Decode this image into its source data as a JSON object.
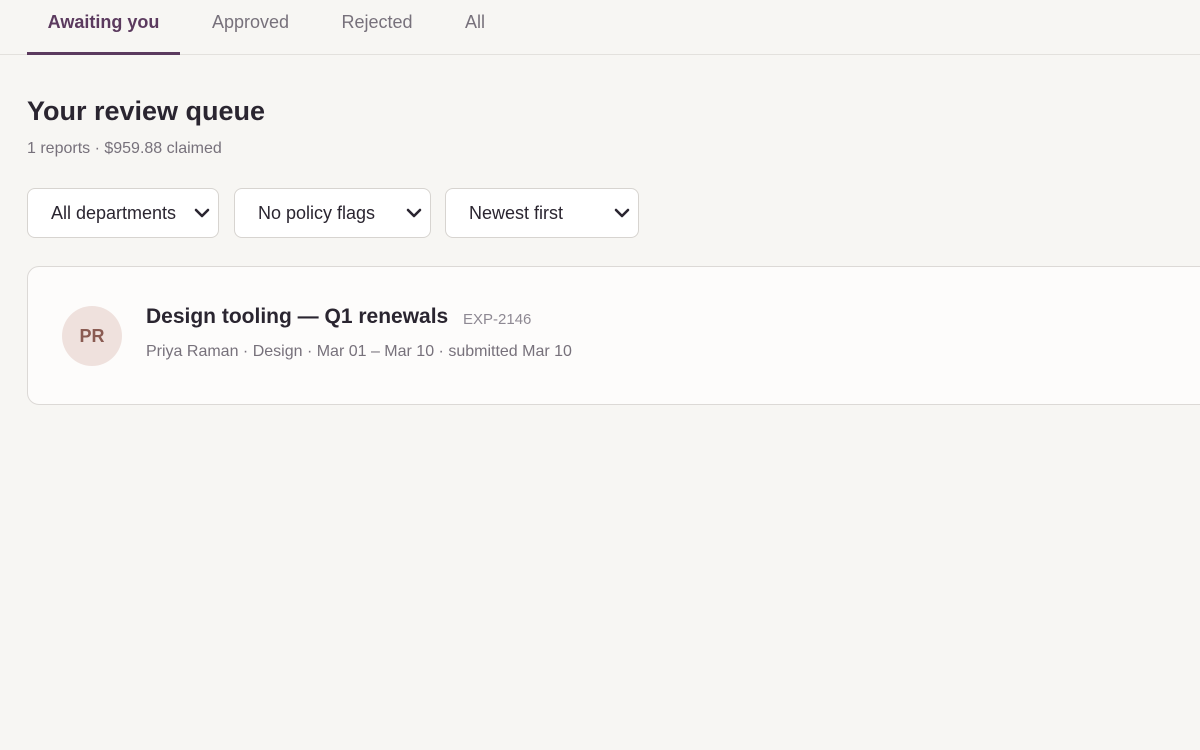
{
  "tabs": {
    "awaiting": "Awaiting you",
    "approved": "Approved",
    "rejected": "Rejected",
    "all": "All",
    "active": "awaiting"
  },
  "header": {
    "title": "Your review queue",
    "summary": "1 reports · $959.88 claimed"
  },
  "filters": {
    "department": "All departments",
    "policy_flags": "No policy flags",
    "sort": "Newest first",
    "chevron_icon": "chevron-down-icon"
  },
  "reports": [
    {
      "initials": "PR",
      "title": "Design tooling — Q1 renewals",
      "id": "EXP-2146",
      "meta": "Priya Raman · Design · Mar 01 – Mar 10 · submitted Mar 10"
    }
  ],
  "colors": {
    "accent": "#5b3a5e",
    "background": "#f7f6f3",
    "avatar_bg": "#efe1dd",
    "avatar_text": "#8a5b52"
  }
}
